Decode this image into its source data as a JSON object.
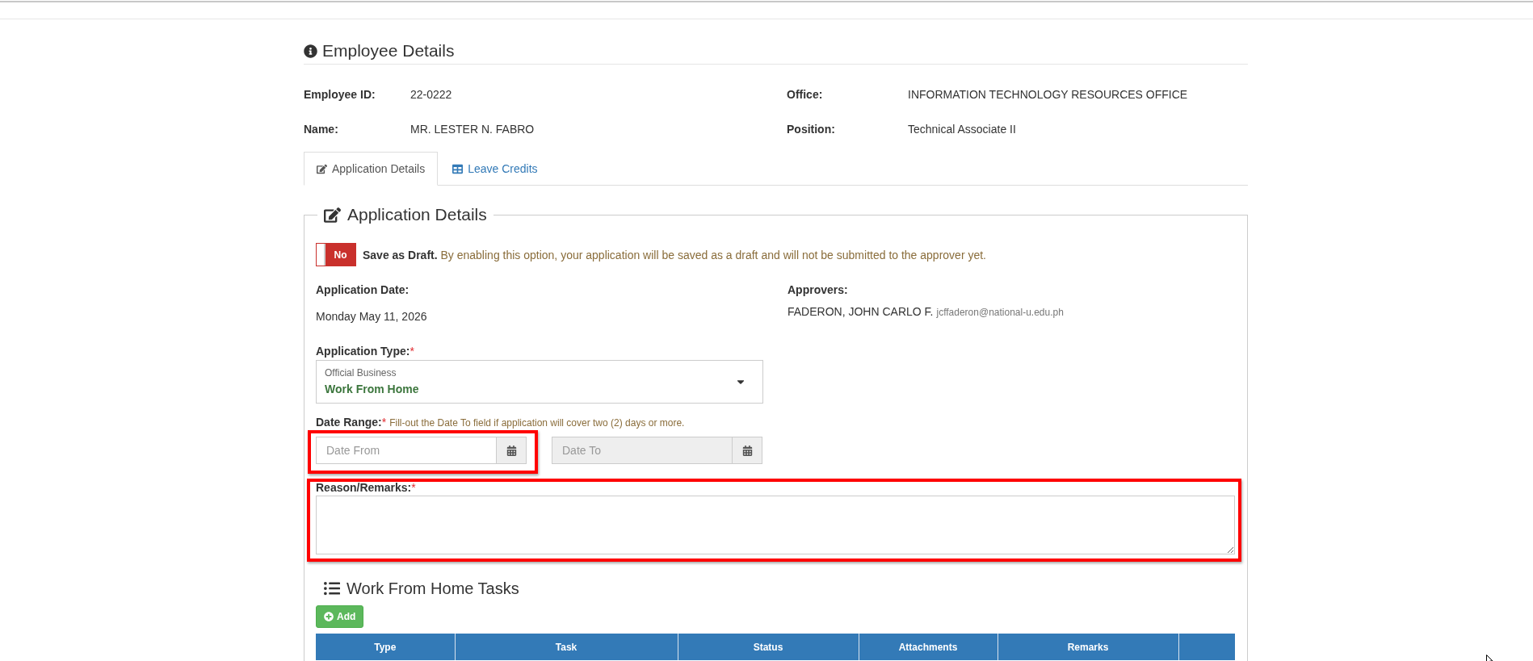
{
  "page_header": {
    "title": "Employee Details"
  },
  "employee": [
    {
      "label": "Employee ID:",
      "value": "22-0222"
    },
    {
      "label": "Office:",
      "value": "INFORMATION TECHNOLOGY RESOURCES OFFICE"
    },
    {
      "label": "Name:",
      "value": "MR. LESTER N. FABRO"
    },
    {
      "label": "Position:",
      "value": "Technical Associate II"
    }
  ],
  "tabs": [
    {
      "label": "Application Details",
      "kind": "edit",
      "selected": true
    },
    {
      "label": "Leave Credits",
      "kind": "table",
      "selected": false
    }
  ],
  "application": {
    "legend": "Application Details",
    "draft_toggle": {
      "label": "No",
      "on": false
    },
    "draft_note": "**Save as Draft.** By enabling this option, your application will be saved as a draft and will not be submitted to the approver yet.",
    "application_date": {
      "label": "Application Date:",
      "value": "Monday May 11, 2026"
    },
    "approvers": {
      "label": "Approvers:",
      "items": [
        {
          "name": "FADERON, JOHN CARLO F.",
          "email": "jcffaderon@national-u.edu.ph"
        }
      ]
    },
    "application_type": {
      "label": "Application Type:",
      "required_mark": "*",
      "category": "Official Business",
      "value": "Work From Home"
    },
    "date_range": {
      "label": "Date Range:",
      "required_mark": "*",
      "hint": "Fill-out the Date To field if application will cover two (2) days or more.",
      "fields": [
        {
          "placeholder": "Date From",
          "disabled": false,
          "highlighted": true
        },
        {
          "placeholder": "Date To",
          "disabled": true,
          "highlighted": false
        }
      ]
    },
    "reason": {
      "label": "Reason/Remarks:",
      "required_mark": "*",
      "highlighted": true
    },
    "tasks": {
      "title": "Work From Home Tasks",
      "add_button": "Add",
      "columns": [
        {
          "kind": "text",
          "label": "Type"
        },
        {
          "kind": "text",
          "label": "Task"
        },
        {
          "kind": "text",
          "label": "Status"
        },
        {
          "kind": "text",
          "label": "Attachments"
        },
        {
          "kind": "text",
          "label": "Remarks"
        },
        {
          "kind": "blank"
        }
      ]
    }
  }
}
